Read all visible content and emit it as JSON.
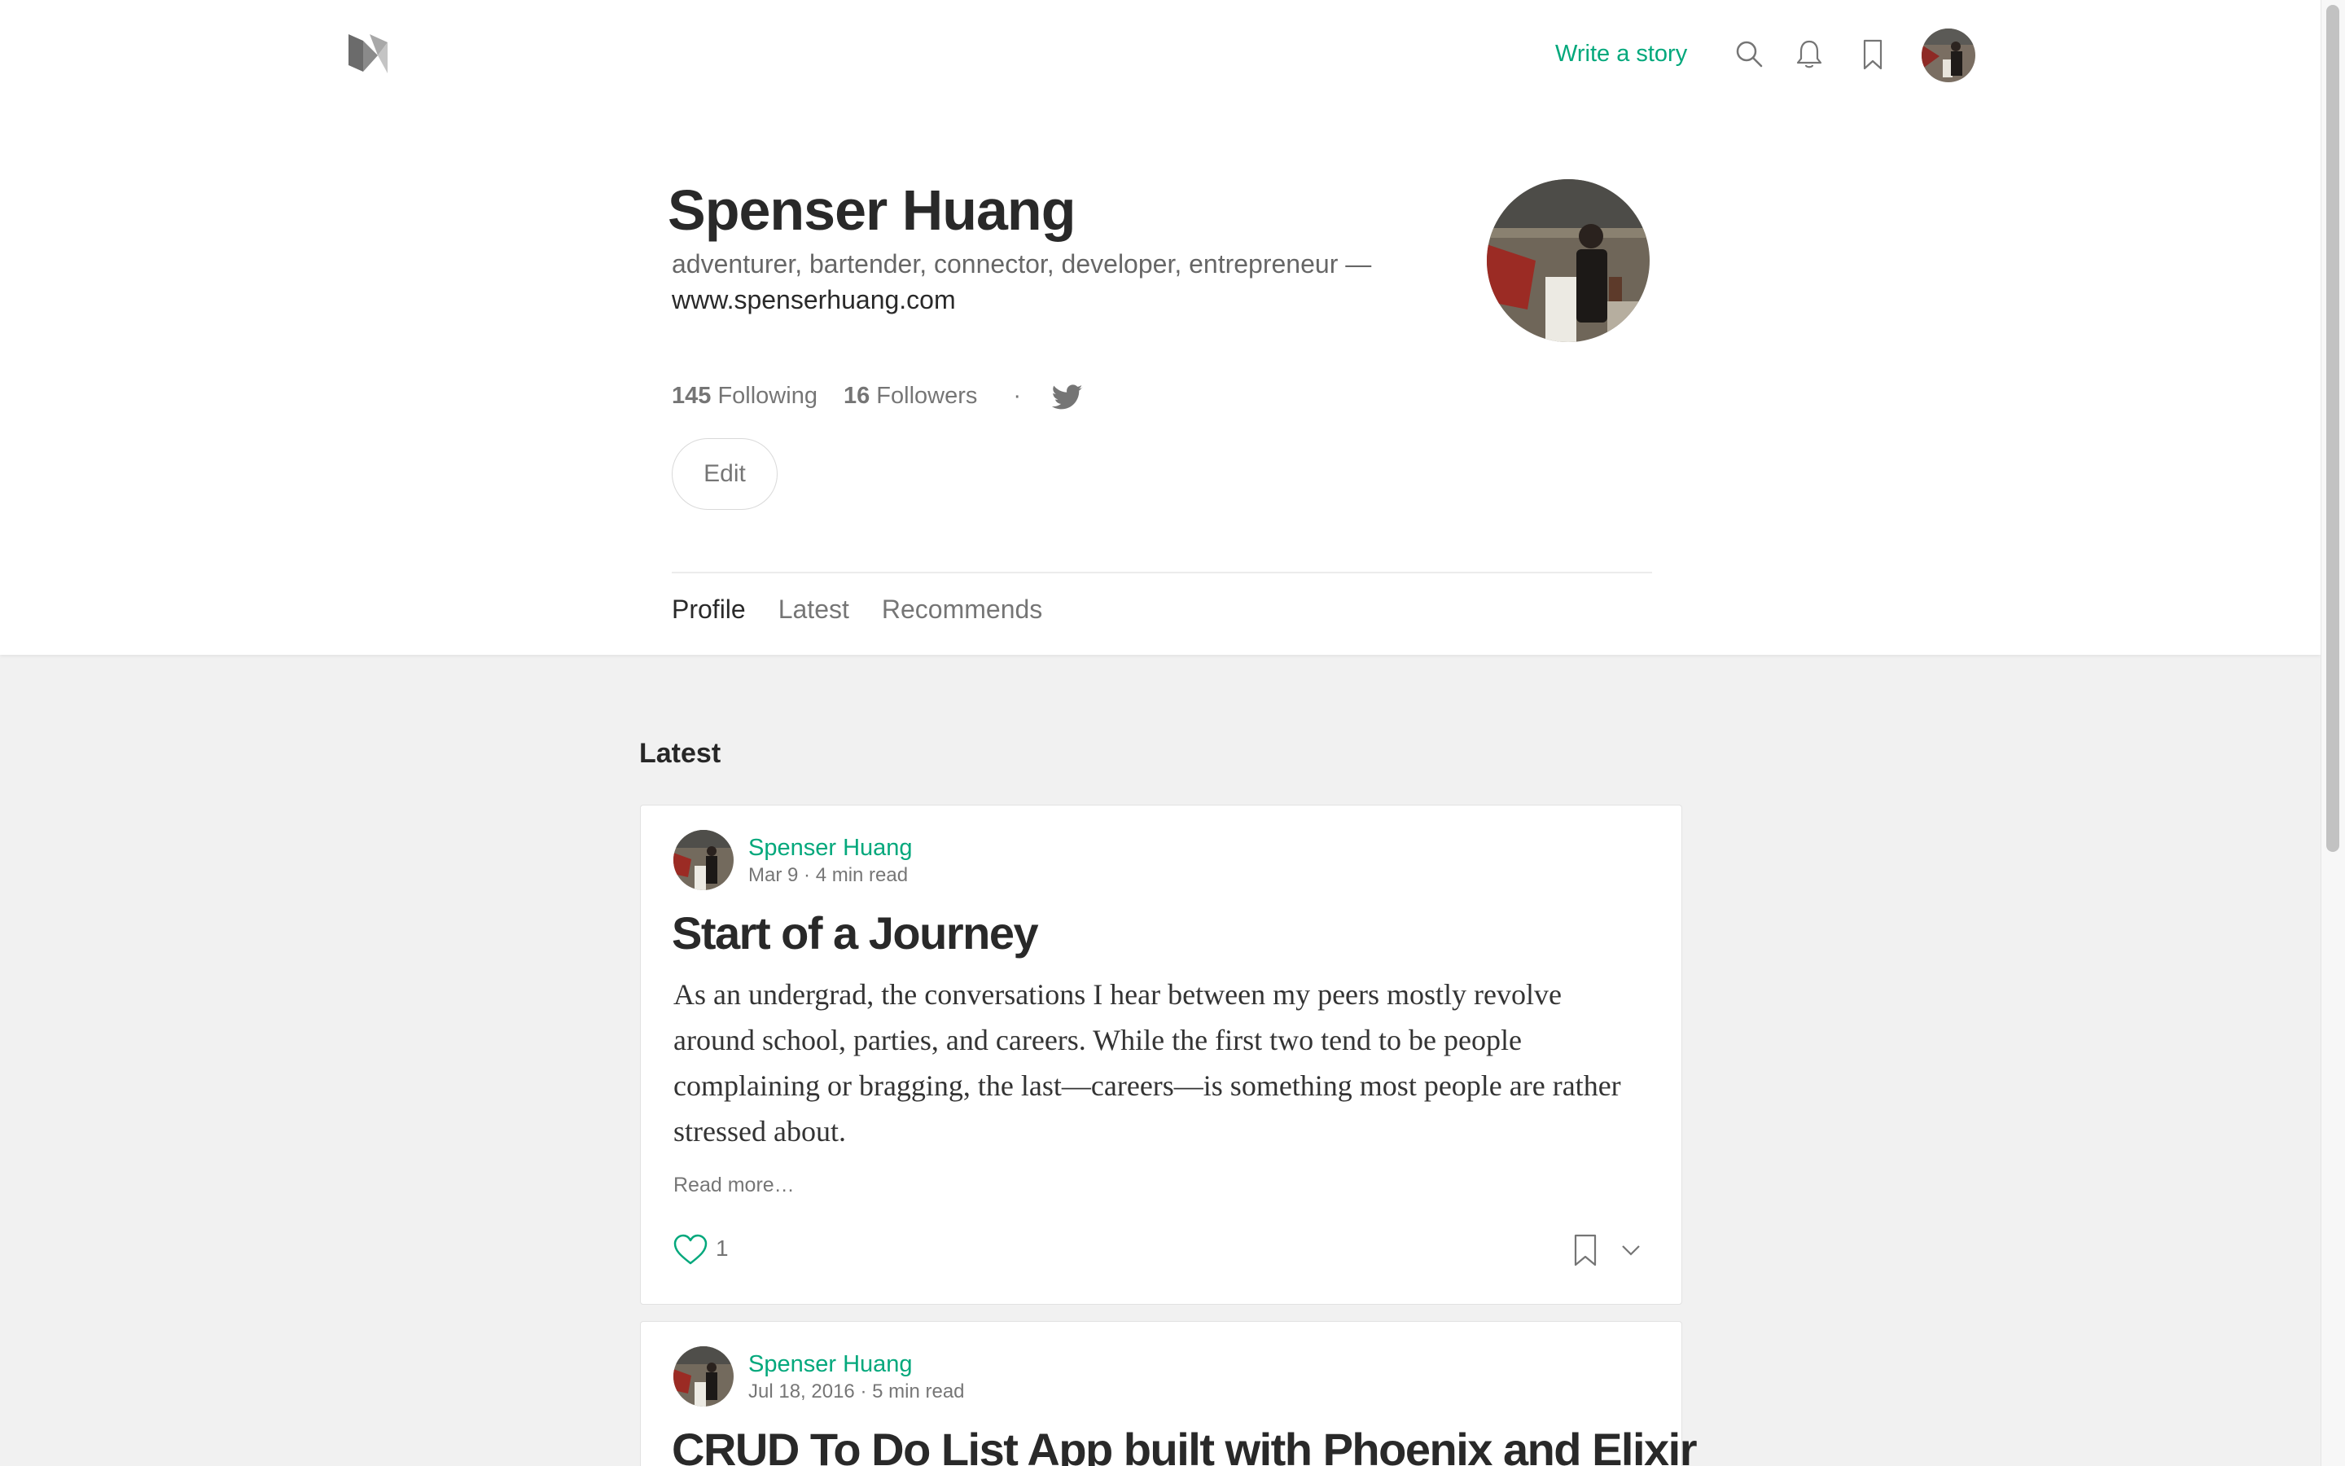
{
  "header": {
    "write_story": "Write a story"
  },
  "colors": {
    "accent": "#03a87c",
    "page_bg": "#f1f1f1"
  },
  "icons": [
    "medium-logo-icon",
    "search-icon",
    "bell-icon",
    "bookmark-icon",
    "twitter-icon",
    "heart-icon",
    "chevron-down-icon"
  ],
  "profile": {
    "name": "Spenser Huang",
    "bio": "adventurer, bartender, connector, developer, entrepreneur —",
    "website": "www.spenserhuang.com",
    "following_count": "145",
    "following_label": "Following",
    "followers_count": "16",
    "followers_label": "Followers",
    "dot": "·",
    "edit_label": "Edit"
  },
  "tabs": [
    {
      "label": "Profile",
      "active": true
    },
    {
      "label": "Latest",
      "active": false
    },
    {
      "label": "Recommends",
      "active": false
    }
  ],
  "latest": {
    "section_title": "Latest",
    "posts": [
      {
        "author": "Spenser Huang",
        "date": "Mar 9",
        "read_time": "4 min read",
        "title": "Start of a Journey",
        "excerpt": "As an undergrad, the conversations I hear between my peers mostly revolve around school, parties, and careers. While the first two tend to be people complaining or bragging, the last—careers—is something most people are rather stressed about.",
        "read_more": "Read more…",
        "claps": "1"
      },
      {
        "author": "Spenser Huang",
        "date": "Jul 18, 2016",
        "read_time": "5 min read",
        "title": "CRUD To Do List App built with Phoenix and Elixir"
      }
    ]
  }
}
